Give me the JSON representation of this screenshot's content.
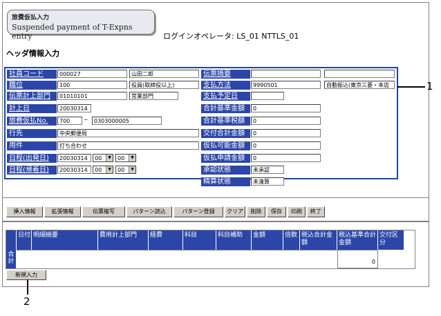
{
  "title_badge": {
    "line1": "旅費仮払入力",
    "line2": "Suspended payment of T-Expns entry"
  },
  "operator": "ログインオペレータ: LS_01 NTTLS_01",
  "section_title": "ヘッダ情報入力",
  "header_left": {
    "employee_code": {
      "label": "社員コード",
      "value": "000027",
      "name": "山田二郎"
    },
    "position": {
      "label": "職位",
      "value": "100",
      "name": "役員(取締役以上)"
    },
    "slip_department": {
      "label": "伝票計上部門",
      "value": "01010101",
      "name": "営業部門"
    },
    "posting_date": {
      "label": "計上日",
      "value": "20030314"
    },
    "travel_advance_no": {
      "label": "旅費仮払No.",
      "value1": "700",
      "dash": "–",
      "value2": "0303000005"
    },
    "destination": {
      "label": "行先",
      "value": "中央郵便局"
    },
    "purpose": {
      "label": "用件",
      "value": "打ち合わせ"
    },
    "departure": {
      "label": "日程(出発日)",
      "date": "20030314",
      "hour": "00",
      "minute": "00"
    },
    "return": {
      "label": "日程(帰着日)",
      "date": "20030314",
      "hour": "00",
      "minute": "00"
    }
  },
  "header_right": {
    "slip_summary": {
      "label": "伝票摘要",
      "value1": "",
      "value2": ""
    },
    "payment_method": {
      "label": "支払方法",
      "value": "9990501",
      "name": "自動振込(東京三菱・本店"
    },
    "payment_due": {
      "label": "支払予定日",
      "value": ""
    },
    "total_base": {
      "label": "合計基準金額",
      "value": "0"
    },
    "total_base_tax": {
      "label": "合計基準税額",
      "value": "0"
    },
    "delivery_total": {
      "label": "交付合計金額",
      "value": "0"
    },
    "advance_possible": {
      "label": "仮払可能金額",
      "value": "0"
    },
    "advance_request": {
      "label": "仮払申請金額",
      "value": "0"
    },
    "approval_status": {
      "label": "承認状態",
      "value": "未承認"
    },
    "settlement_status": {
      "label": "精算状態",
      "value": "未清算"
    }
  },
  "toolbar": [
    "挿入情報",
    "拡張情報",
    "伝票複写",
    "パターン読込",
    "パターン登録",
    "クリア",
    "削除",
    "保存",
    "印刷",
    "終了"
  ],
  "detail_grid": {
    "headers": [
      "日付",
      "明細摘要",
      "費用計上部門",
      "経費",
      "科目",
      "科目補助",
      "金額",
      "倍数",
      "税込合計金額",
      "税込基準合計金額",
      "交付区分"
    ],
    "total_label": "合計",
    "total_value": "0"
  },
  "new_entry_button": "新規入力",
  "callouts": {
    "c1": "1",
    "c2": "2"
  }
}
